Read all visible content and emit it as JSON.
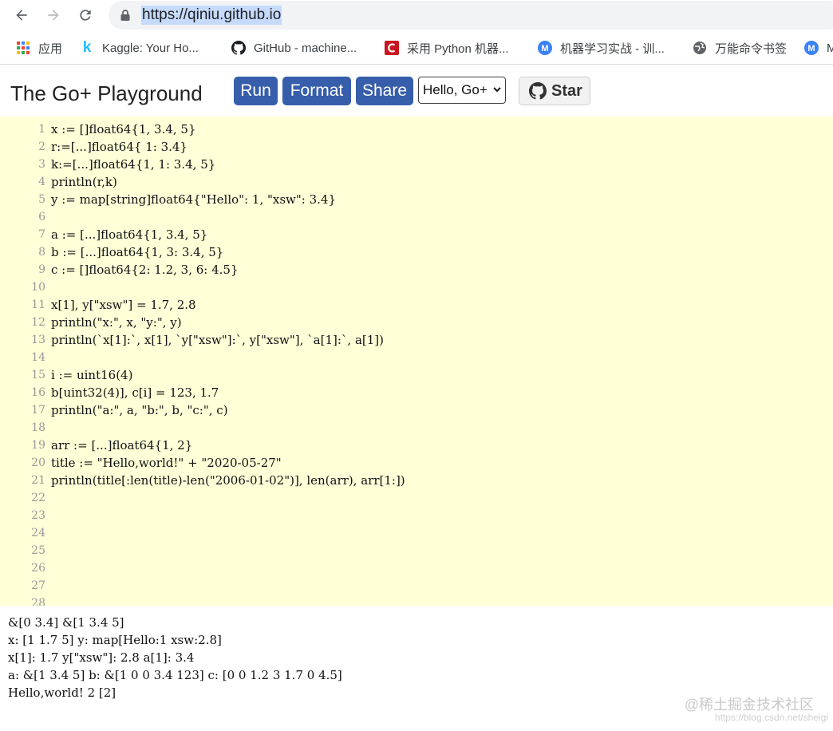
{
  "browser": {
    "url": "https://qiniu.github.io",
    "bookmarks": [
      {
        "icon": "apps-grid-icon",
        "label": "应用"
      },
      {
        "icon": "kaggle-icon",
        "label": "Kaggle: Your Ho..."
      },
      {
        "icon": "github-icon",
        "label": "GitHub - machine..."
      },
      {
        "icon": "csdn-icon",
        "label": "采用 Python 机器..."
      },
      {
        "icon": "m-icon",
        "label": "机器学习实战 - 训..."
      },
      {
        "icon": "globe-icon",
        "label": "万能命令书签"
      },
      {
        "icon": "m-icon",
        "label": "M"
      }
    ]
  },
  "header": {
    "title": "The Go+ Playground",
    "run_label": "Run",
    "format_label": "Format",
    "share_label": "Share",
    "example_selected": "Hello, Go+",
    "star_label": "Star",
    "button_color": "#375eab"
  },
  "editor": {
    "background": "#ffffd8",
    "lines": [
      {
        "no": "1",
        "code": "x := []float64{1, 3.4, 5}"
      },
      {
        "no": "2",
        "code": "r:=[...]float64{ 1: 3.4}"
      },
      {
        "no": "3",
        "code": "k:=[...]float64{1, 1: 3.4, 5}"
      },
      {
        "no": "4",
        "code": "println(r,k)"
      },
      {
        "no": "5",
        "code": "y := map[string]float64{\"Hello\": 1, \"xsw\": 3.4}"
      },
      {
        "no": "6",
        "code": ""
      },
      {
        "no": "7",
        "code": "a := [...]float64{1, 3.4, 5}"
      },
      {
        "no": "8",
        "code": "b := [...]float64{1, 3: 3.4, 5}"
      },
      {
        "no": "9",
        "code": "c := []float64{2: 1.2, 3, 6: 4.5}"
      },
      {
        "no": "10",
        "code": ""
      },
      {
        "no": "11",
        "code": "x[1], y[\"xsw\"] = 1.7, 2.8"
      },
      {
        "no": "12",
        "code": "println(\"x:\", x, \"y:\", y)"
      },
      {
        "no": "13",
        "code": "println(`x[1]:`, x[1], `y[\"xsw\"]:`, y[\"xsw\"], `a[1]:`, a[1])"
      },
      {
        "no": "14",
        "code": ""
      },
      {
        "no": "15",
        "code": "i := uint16(4)"
      },
      {
        "no": "16",
        "code": "b[uint32(4)], c[i] = 123, 1.7"
      },
      {
        "no": "17",
        "code": "println(\"a:\", a, \"b:\", b, \"c:\", c)"
      },
      {
        "no": "18",
        "code": ""
      },
      {
        "no": "19",
        "code": "arr := [...]float64{1, 2}"
      },
      {
        "no": "20",
        "code": "title := \"Hello,world!\" + \"2020-05-27\""
      },
      {
        "no": "21",
        "code": "println(title[:len(title)-len(\"2006-01-02\")], len(arr), arr[1:])"
      },
      {
        "no": "22",
        "code": ""
      },
      {
        "no": "23",
        "code": ""
      },
      {
        "no": "24",
        "code": ""
      },
      {
        "no": "25",
        "code": ""
      },
      {
        "no": "26",
        "code": ""
      },
      {
        "no": "27",
        "code": ""
      },
      {
        "no": "28",
        "code": ""
      }
    ]
  },
  "output": {
    "lines": [
      "&[0 3.4] &[1 3.4 5]",
      "x: [1 1.7 5] y: map[Hello:1 xsw:2.8]",
      "x[1]: 1.7 y[\"xsw\"]: 2.8 a[1]: 3.4",
      "a: &[1 3.4 5] b: &[1 0 0 3.4 123] c: [0 0 1.2 3 1.7 0 4.5]",
      "Hello,world! 2 [2]"
    ]
  },
  "watermark": {
    "text": "@稀土掘金技术社区",
    "url": "https://blog.csdn.net/sheigi"
  }
}
